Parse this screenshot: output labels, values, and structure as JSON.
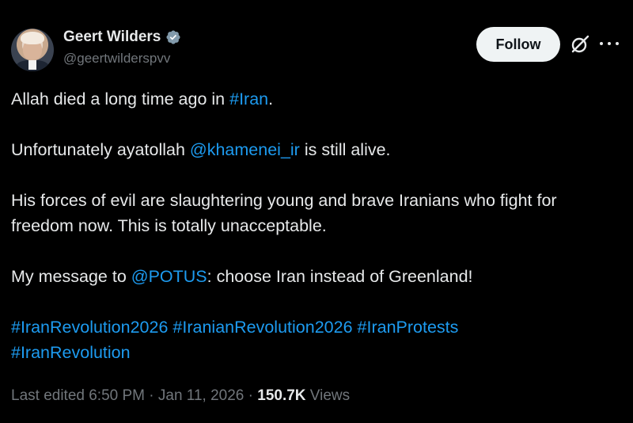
{
  "author": {
    "name": "Geert Wilders",
    "handle": "@geertwilderspvv",
    "verified_color": "#829aab"
  },
  "actions": {
    "follow_label": "Follow",
    "grok_icon": "grok-icon",
    "more_icon": "more-icon"
  },
  "tweet": {
    "line1_prefix": "Allah died a long time ago in ",
    "line1_link": "#Iran",
    "line1_suffix": ".",
    "line2_prefix": "Unfortunately ayatollah ",
    "line2_link": "@khamenei_ir",
    "line2_suffix": " is still alive.",
    "para3_line1": "His forces of evil are slaughtering young and brave Iranians who fight for",
    "para3_line2": "freedom now. This is totally unacceptable.",
    "line4_prefix": "My message to ",
    "line4_link": "@POTUS",
    "line4_suffix": ": choose Iran instead of Greenland!",
    "hashtags_line1": [
      "#IranRevolution2026",
      "#IranianRevolution2026",
      "#IranProtests"
    ],
    "hashtags_line2": [
      "#IranRevolution"
    ]
  },
  "meta": {
    "edited_label": "Last edited 6:50 PM",
    "separator": " · ",
    "date": "Jan 11, 2026",
    "views_count": "150.7K",
    "views_label": " Views"
  },
  "colors": {
    "background": "#000000",
    "text": "#e7e9ea",
    "link": "#1d9bf0",
    "muted": "#71767b"
  }
}
